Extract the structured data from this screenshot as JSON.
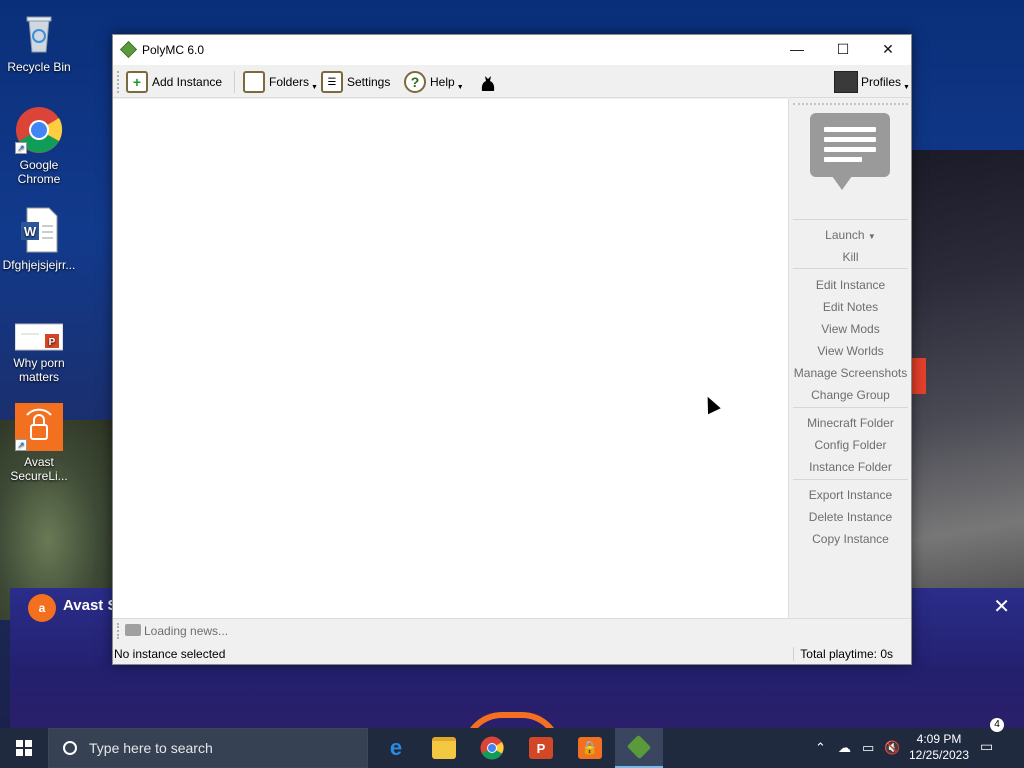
{
  "desktop": {
    "icons": [
      {
        "label": "Recycle Bin"
      },
      {
        "label": "Google Chrome"
      },
      {
        "label": "Dfghjejsjejrr..."
      },
      {
        "label": "Why porn matters"
      },
      {
        "label": "Avast SecureLi..."
      }
    ]
  },
  "avast_banner": {
    "title": "Avast S",
    "close_glyph": "✕"
  },
  "window": {
    "title": "PolyMC 6.0",
    "controls": {
      "minimize": "—",
      "maximize": "☐",
      "close": "✕"
    },
    "toolbar": {
      "add_instance": "Add Instance",
      "folders": "Folders",
      "settings": "Settings",
      "help": "Help",
      "profiles": "Profiles"
    },
    "side_panel": {
      "launch": "Launch",
      "kill": "Kill",
      "edit_instance": "Edit Instance",
      "edit_notes": "Edit Notes",
      "view_mods": "View Mods",
      "view_worlds": "View Worlds",
      "manage_screenshots": "Manage Screenshots",
      "change_group": "Change Group",
      "minecraft_folder": "Minecraft Folder",
      "config_folder": "Config Folder",
      "instance_folder": "Instance Folder",
      "export_instance": "Export Instance",
      "delete_instance": "Delete Instance",
      "copy_instance": "Copy Instance"
    },
    "news": "Loading news...",
    "status": {
      "left": "No instance selected",
      "right": "Total playtime: 0s"
    }
  },
  "taskbar": {
    "search_placeholder": "Type here to search",
    "time": "4:09 PM",
    "date": "12/25/2023",
    "notification_count": "4"
  },
  "colors": {
    "accent_green": "#5a9a3a",
    "avast_orange": "#f37021",
    "taskbar": "#1f2a3f",
    "disabled_text": "#6e6e6e"
  }
}
